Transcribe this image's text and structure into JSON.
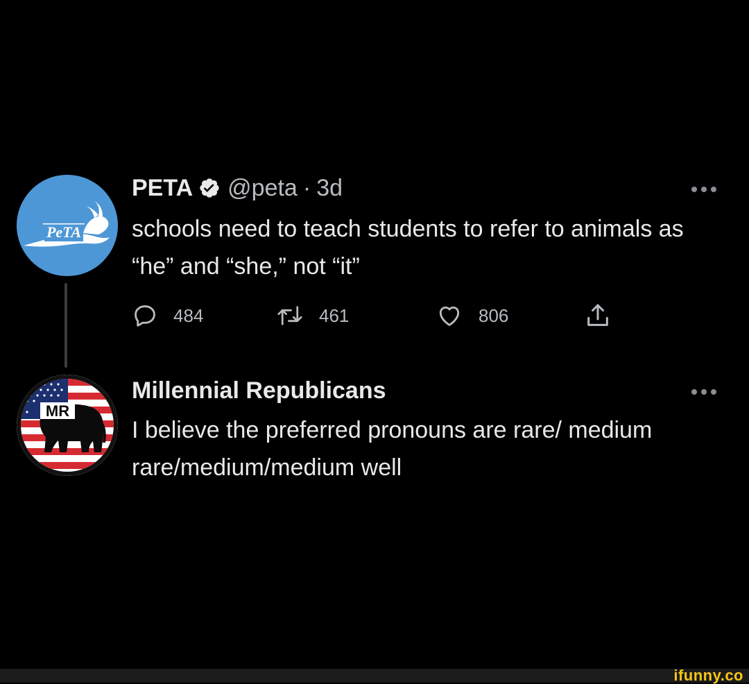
{
  "tweets": [
    {
      "display_name": "PETA",
      "verified": true,
      "handle": "@peta",
      "separator": "·",
      "time": "3d",
      "text": "schools need to teach students to refer to animals as “he” and “she,” not “it”",
      "avatar_icon": "peta-logo-avatar",
      "avatar_text": "PeTA",
      "avatar_color": "#4d97d6",
      "actions": {
        "replies": "484",
        "retweets": "461",
        "likes": "806"
      }
    },
    {
      "display_name": "Millennial Republicans",
      "text": "I believe the preferred pronouns are rare/ medium rare/medium/medium well",
      "avatar_icon": "millennial-republicans-flag-elephant-avatar",
      "avatar_text": "MR"
    }
  ],
  "icons": {
    "more": "more-horizontal-icon",
    "reply": "speech-bubble-icon",
    "retweet": "retweet-arrows-icon",
    "like": "heart-icon",
    "share": "share-upload-icon",
    "verified": "verified-badge-icon"
  },
  "colors": {
    "background": "#000000",
    "text": "#e7e9ea",
    "secondary_text": "#b8bcc0",
    "watermark": "#f5c518"
  },
  "watermark": "ifunny.co"
}
